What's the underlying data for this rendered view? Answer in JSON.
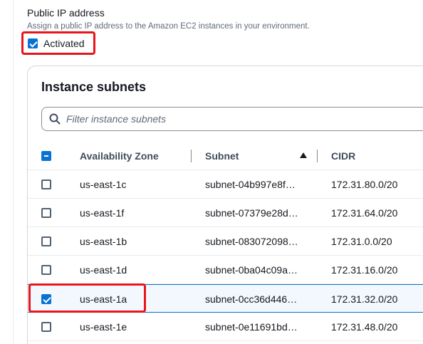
{
  "public_ip": {
    "label": "Public IP address",
    "description": "Assign a public IP address to the Amazon EC2 instances in your environment.",
    "activated_label": "Activated",
    "activated_checked": true
  },
  "subnets": {
    "title": "Instance subnets",
    "search_placeholder": "Filter instance subnets",
    "columns": {
      "availability_zone": "Availability Zone",
      "subnet": "Subnet",
      "cidr": "CIDR"
    },
    "sort_icon": "sort-ascending-icon",
    "rows": [
      {
        "az": "us-east-1c",
        "subnet": "subnet-04b997e8f…",
        "cidr": "172.31.80.0/20",
        "checked": false
      },
      {
        "az": "us-east-1f",
        "subnet": "subnet-07379e28d…",
        "cidr": "172.31.64.0/20",
        "checked": false
      },
      {
        "az": "us-east-1b",
        "subnet": "subnet-083072098…",
        "cidr": "172.31.0.0/20",
        "checked": false
      },
      {
        "az": "us-east-1d",
        "subnet": "subnet-0ba04c09a…",
        "cidr": "172.31.16.0/20",
        "checked": false
      },
      {
        "az": "us-east-1a",
        "subnet": "subnet-0cc36d446…",
        "cidr": "172.31.32.0/20",
        "checked": true
      },
      {
        "az": "us-east-1e",
        "subnet": "subnet-0e11691bd…",
        "cidr": "172.31.48.0/20",
        "checked": false
      }
    ]
  },
  "colors": {
    "accent": "#0972d3",
    "highlight_box": "#e8151b"
  }
}
